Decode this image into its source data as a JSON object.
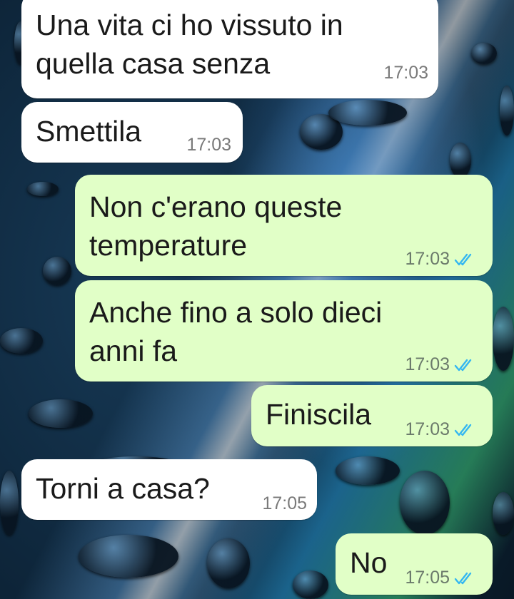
{
  "chat": {
    "messages": [
      {
        "direction": "incoming",
        "lines": "Una vita ci ho vissuto in\nquella casa senza",
        "time": "17:03"
      },
      {
        "direction": "incoming",
        "lines": "Smettila",
        "time": "17:03"
      },
      {
        "direction": "outgoing",
        "lines": "Non c'erano queste\ntemperature",
        "time": "17:03",
        "status": "read"
      },
      {
        "direction": "outgoing",
        "lines": "Anche fino a solo dieci\nanni fa",
        "time": "17:03",
        "status": "read"
      },
      {
        "direction": "outgoing",
        "lines": "Finiscila",
        "time": "17:03",
        "status": "read"
      },
      {
        "direction": "incoming",
        "lines": "Torni a casa?",
        "time": "17:05"
      },
      {
        "direction": "outgoing",
        "lines": "No",
        "time": "17:05",
        "status": "read"
      }
    ]
  },
  "colors": {
    "incoming_bubble": "#ffffff",
    "outgoing_bubble": "#e1ffc7",
    "read_ticks": "#34b7f1"
  },
  "icons": {
    "read_receipt": "double-check-icon"
  }
}
